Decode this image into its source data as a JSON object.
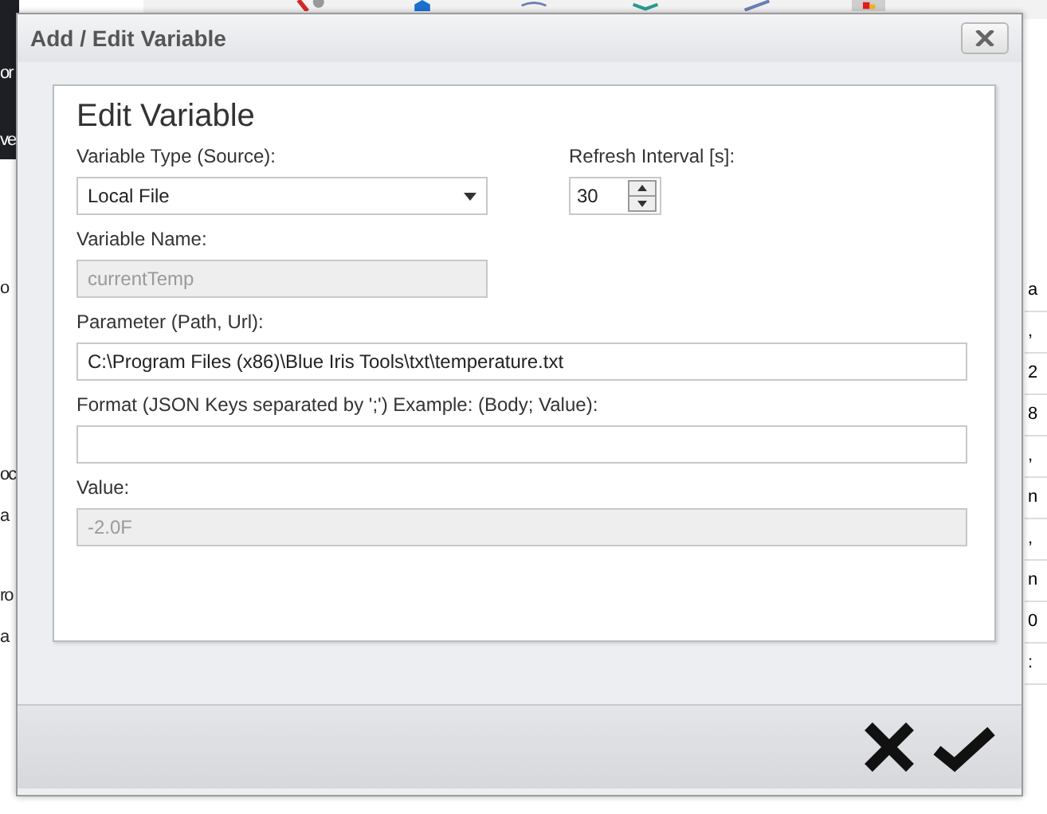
{
  "background": {
    "left_texts": [
      "or",
      "ve",
      "o",
      "oc",
      "a",
      "ro",
      "a"
    ],
    "right_texts": [
      "a",
      ",",
      "2",
      "8",
      ",",
      "n",
      ",",
      "n",
      "0",
      ":"
    ]
  },
  "dialog": {
    "title": "Add / Edit Variable",
    "heading": "Edit Variable",
    "fields": [
      {
        "kind": "dropdown",
        "label": "Variable Type (Source):",
        "value": "Local File",
        "disabled": false
      },
      {
        "kind": "spinner",
        "label": "Refresh Interval [s]:",
        "value": "30",
        "disabled": false
      },
      {
        "kind": "text",
        "label": "Variable Name:",
        "value": "currentTemp",
        "disabled": true
      },
      {
        "kind": "text",
        "label": "Parameter (Path, Url):",
        "value": "C:\\Program Files (x86)\\Blue Iris Tools\\txt\\temperature.txt",
        "disabled": false
      },
      {
        "kind": "text",
        "label": "Format (JSON Keys separated by ';') Example: (Body; Value):",
        "disabled": false
      },
      {
        "kind": "text",
        "label": "Value:",
        "value": "-2.0F",
        "disabled": true
      }
    ]
  }
}
